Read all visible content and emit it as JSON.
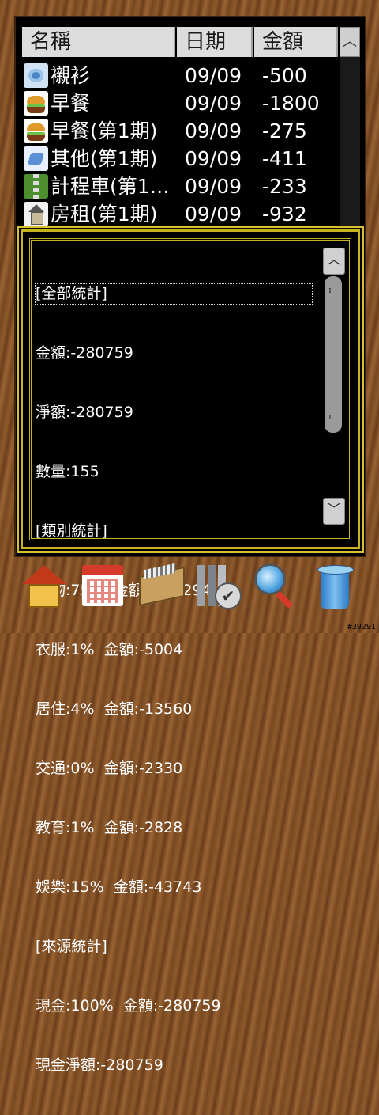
{
  "table": {
    "headers": {
      "name": "名稱",
      "date": "日期",
      "amount": "金額"
    },
    "rows": [
      {
        "icon": "shirt-icon",
        "name": "襯衫",
        "date": "09/09",
        "amount": "-500"
      },
      {
        "icon": "burger-icon",
        "name": "早餐",
        "date": "09/09",
        "amount": "-1800"
      },
      {
        "icon": "burger-icon",
        "name": "早餐(第1期)",
        "date": "09/09",
        "amount": "-275"
      },
      {
        "icon": "other-icon",
        "name": "其他(第1期)",
        "date": "09/09",
        "amount": "-411"
      },
      {
        "icon": "road-icon",
        "name": "計程車(第1…",
        "date": "09/09",
        "amount": "-233"
      },
      {
        "icon": "house-icon",
        "name": "房租(第1期)",
        "date": "09/09",
        "amount": "-932"
      }
    ]
  },
  "stats": {
    "lines": [
      "[全部統計]",
      "金額:-280759",
      "淨額:-280759",
      "數量:155",
      "[類別統計]",
      "食物:75%  金額:-213294",
      "衣服:1%  金額:-5004",
      "居住:4%  金額:-13560",
      "交通:0%  金額:-2330",
      "教育:1%  金額:-2828",
      "娛樂:15%  金額:-43743",
      "[來源統計]",
      "現金:100%  金額:-280759",
      "現金淨額:-280759"
    ]
  },
  "toolbar": {
    "icons": [
      "home-icon",
      "calendar-icon",
      "records-icon",
      "chart-check-icon",
      "search-icon",
      "trash-icon"
    ]
  },
  "corner_code": "#39291"
}
